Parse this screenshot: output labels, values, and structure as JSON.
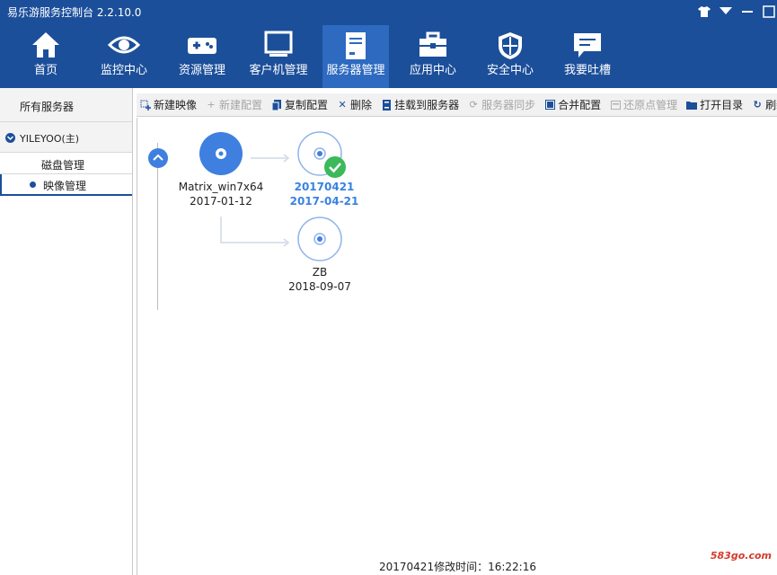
{
  "window": {
    "title": "易乐游服务控制台 2.2.10.0"
  },
  "nav": {
    "items": [
      {
        "label": "首页",
        "icon": "home-icon"
      },
      {
        "label": "监控中心",
        "icon": "eye-icon"
      },
      {
        "label": "资源管理",
        "icon": "gamepad-icon"
      },
      {
        "label": "客户机管理",
        "icon": "monitor-icon"
      },
      {
        "label": "服务器管理",
        "icon": "server-icon",
        "active": true
      },
      {
        "label": "应用中心",
        "icon": "toolbox-icon"
      },
      {
        "label": "安全中心",
        "icon": "shield-icon"
      },
      {
        "label": "我要吐槽",
        "icon": "chat-icon"
      }
    ]
  },
  "sidebar": {
    "all_servers": "所有服务器",
    "server_name": "YILEYOO(主)",
    "items": [
      {
        "label": "磁盘管理"
      },
      {
        "label": "映像管理"
      }
    ]
  },
  "toolbar": {
    "new_image": "新建映像",
    "new_config": "新建配置",
    "copy_config": "复制配置",
    "delete": "删除",
    "mount": "挂载到服务器",
    "sync": "服务器同步",
    "merge": "合并配置",
    "restore": "还原点管理",
    "open_dir": "打开目录",
    "refresh": "刷新"
  },
  "tree": {
    "root": {
      "name": "Matrix_win7x64",
      "date": "2017-01-12"
    },
    "child1": {
      "name": "20170421",
      "date": "2017-04-21"
    },
    "child2": {
      "name": "ZB",
      "date": "2018-09-07"
    }
  },
  "status": "20170421修改时间：16:22:16",
  "watermark": "583go.com",
  "colors": {
    "nav_bg": "#1c4f9a",
    "nav_active": "#2d6ac0",
    "accent": "#3f7fe0",
    "check": "#3cb95a"
  }
}
